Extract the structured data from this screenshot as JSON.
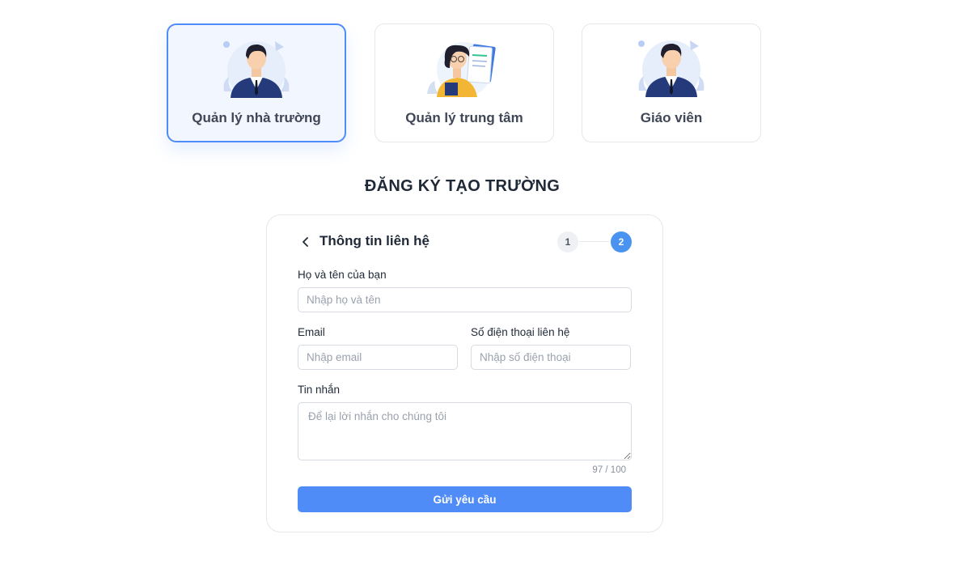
{
  "roles": [
    {
      "label": "Quản lý nhà trường",
      "selected": true
    },
    {
      "label": "Quản lý trung tâm",
      "selected": false
    },
    {
      "label": "Giáo viên",
      "selected": false
    }
  ],
  "page_title": "ĐĂNG KÝ TẠO TRƯỜNG",
  "form": {
    "heading": "Thông tin liên hệ",
    "back_icon": "chevron-left-icon",
    "steps": [
      "1",
      "2"
    ],
    "active_step": 2,
    "fullname": {
      "label": "Họ và tên của bạn",
      "placeholder": "Nhập họ và tên",
      "value": ""
    },
    "email": {
      "label": "Email",
      "placeholder": "Nhập email",
      "value": ""
    },
    "phone": {
      "label": "Số điện thoại liên hệ",
      "placeholder": "Nhập số điện thoại",
      "value": ""
    },
    "message": {
      "label": "Tin nhắn",
      "placeholder": "Để lại lời nhắn cho chúng tôi",
      "value": "",
      "counter": "97 / 100"
    },
    "submit_label": "Gửi yêu cầu"
  },
  "colors": {
    "accent": "#4f8cf7",
    "step_active": "#4a93f0",
    "selected_card_bg": "#f2f7ff",
    "border": "#e5e7eb"
  }
}
